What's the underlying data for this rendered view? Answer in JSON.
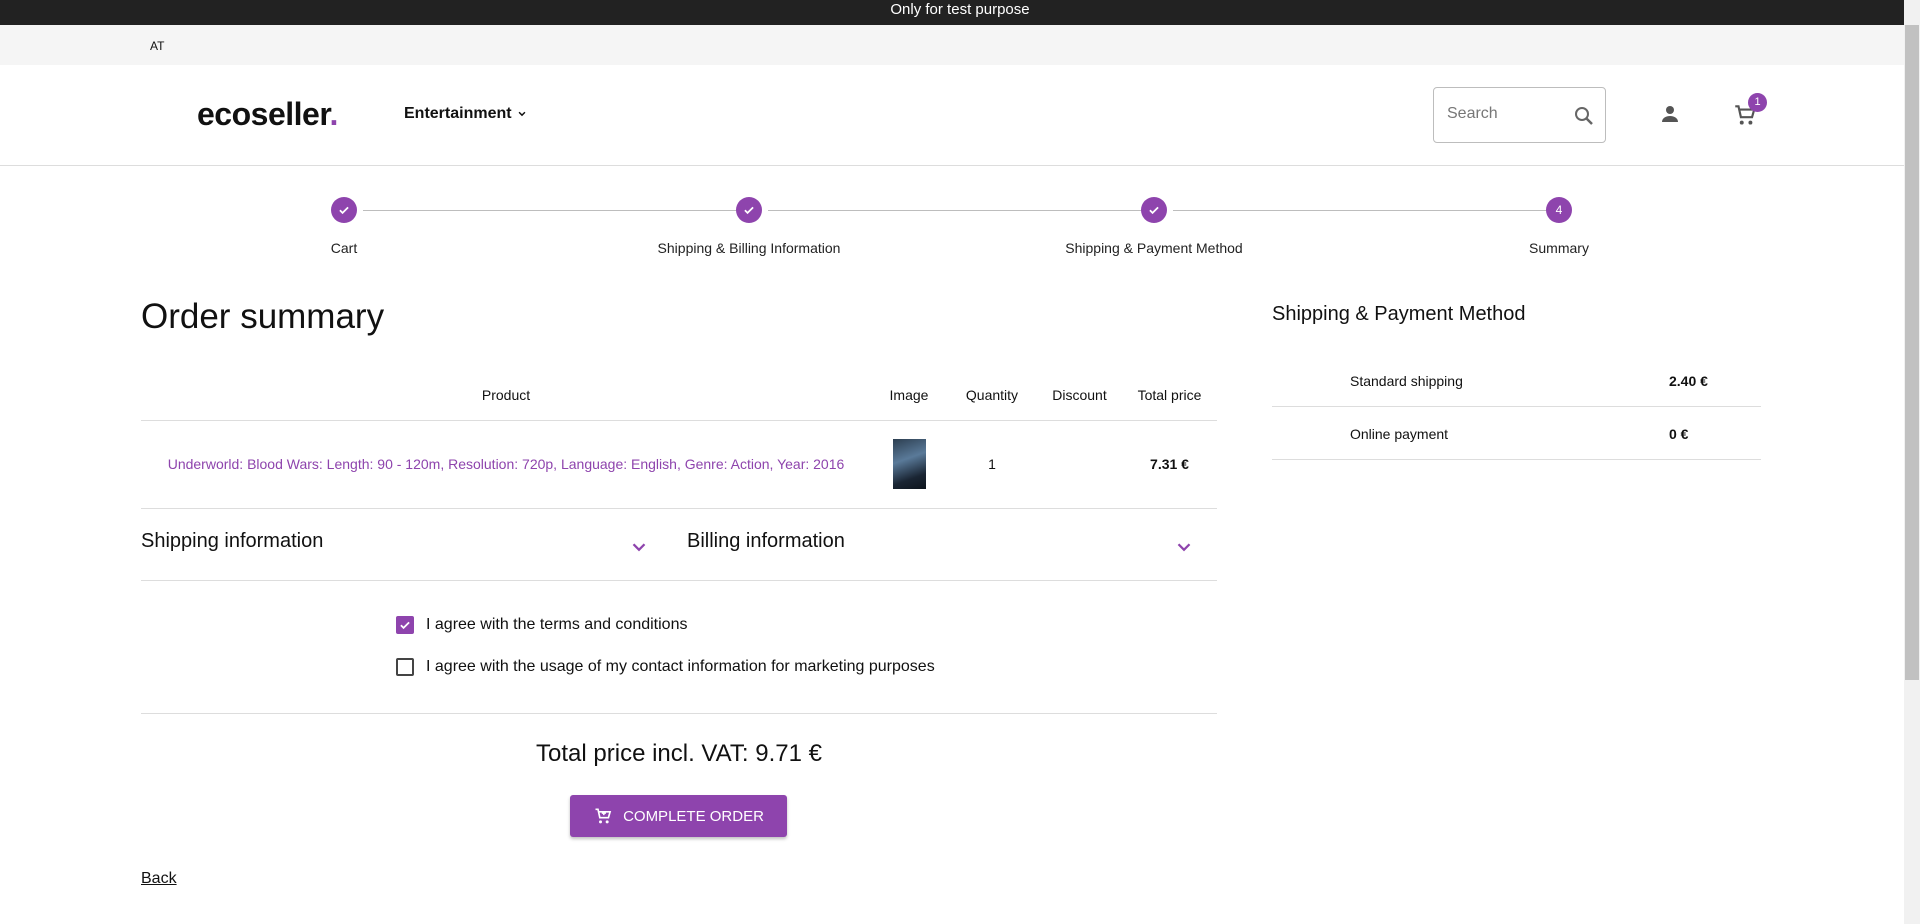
{
  "banner": {
    "text": "Only for test purpose"
  },
  "region": {
    "code": "AT"
  },
  "header": {
    "logo_text": "ecoseller",
    "logo_dot": ".",
    "category": "Entertainment",
    "search_placeholder": "Search",
    "cart_count": "1"
  },
  "steps": [
    {
      "label": "Cart",
      "state": "done"
    },
    {
      "label": "Shipping & Billing Information",
      "state": "done"
    },
    {
      "label": "Shipping & Payment Method",
      "state": "done"
    },
    {
      "label": "Summary",
      "number": "4",
      "state": "current"
    }
  ],
  "order": {
    "title": "Order summary",
    "columns": {
      "product": "Product",
      "image": "Image",
      "quantity": "Quantity",
      "discount": "Discount",
      "total": "Total price"
    },
    "items": [
      {
        "product": "Underworld: Blood Wars: Length: 90 - 120m, Resolution: 720p, Language: English, Genre: Action, Year: 2016",
        "quantity": "1",
        "discount": "",
        "total": "7.31 €"
      }
    ],
    "shipping_info_label": "Shipping information",
    "billing_info_label": "Billing information",
    "terms_label": "I agree with the terms and conditions",
    "terms_checked": true,
    "marketing_label": "I agree with the usage of my contact information for marketing purposes",
    "marketing_checked": false,
    "total_label": "Total price incl. VAT: 9.71 €",
    "complete_label": "COMPLETE ORDER",
    "back_label": "Back"
  },
  "side": {
    "title": "Shipping & Payment Method",
    "rows": [
      {
        "name": "Standard shipping",
        "value": "2.40 €"
      },
      {
        "name": "Online payment",
        "value": "0 €"
      }
    ]
  },
  "colors": {
    "accent": "#8e44ad",
    "banner": "#222222"
  }
}
